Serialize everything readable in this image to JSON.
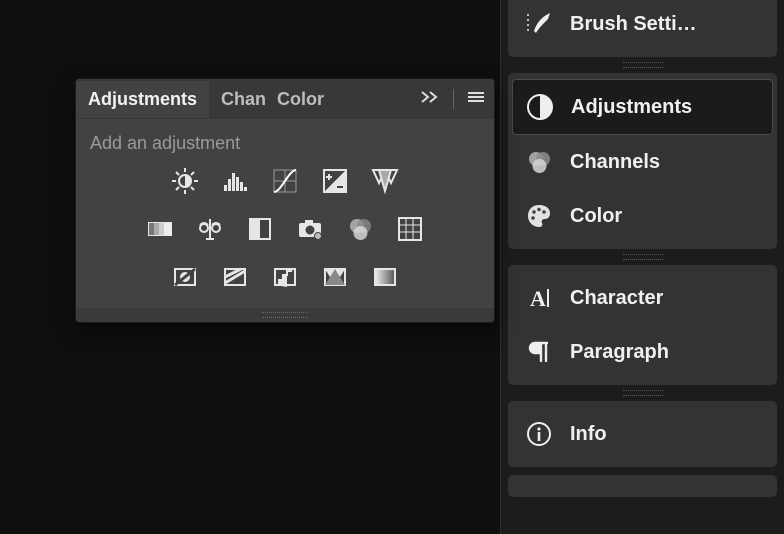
{
  "right_dock": {
    "items": [
      {
        "label": "Brush Setti…"
      },
      {
        "label": "Adjustments"
      },
      {
        "label": "Channels"
      },
      {
        "label": "Color"
      },
      {
        "label": "Character"
      },
      {
        "label": "Paragraph"
      },
      {
        "label": "Info"
      }
    ]
  },
  "float_panel": {
    "tabs": {
      "adjustments": "Adjustments",
      "channels": "Chan",
      "color": "Color"
    },
    "heading": "Add an adjustment"
  }
}
